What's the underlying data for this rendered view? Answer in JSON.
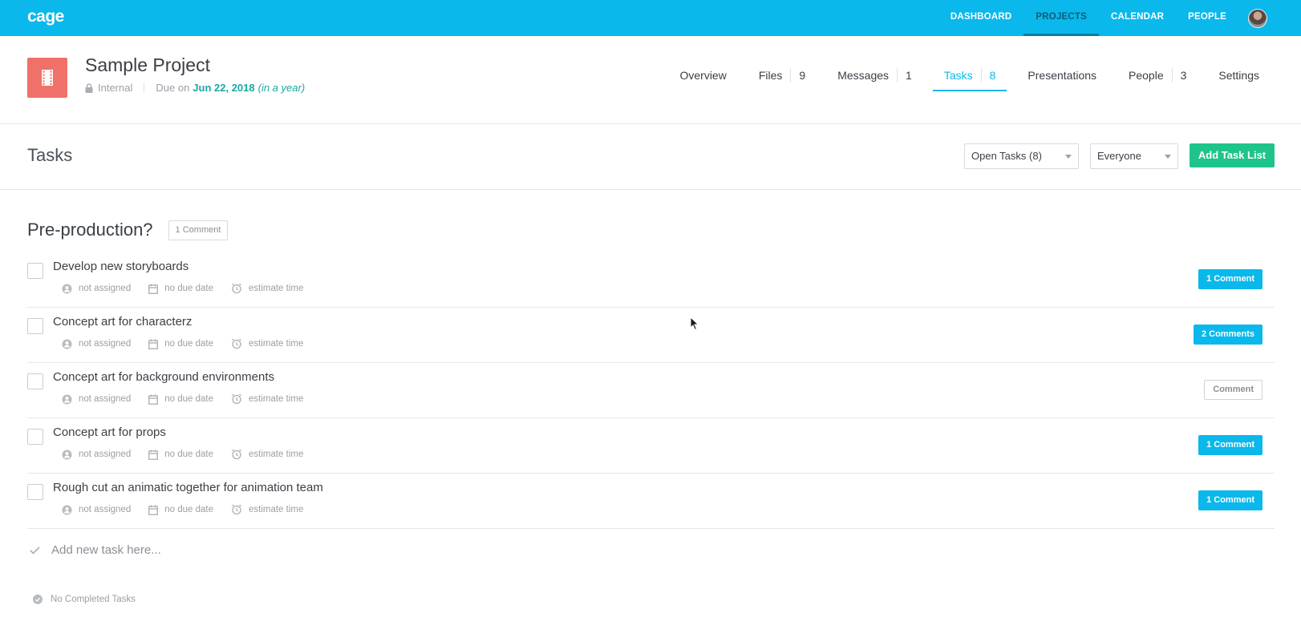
{
  "topbar": {
    "logo": "cage",
    "nav": [
      {
        "label": "DASHBOARD",
        "active": false
      },
      {
        "label": "PROJECTS",
        "active": true
      },
      {
        "label": "CALENDAR",
        "active": false
      },
      {
        "label": "PEOPLE",
        "active": false
      }
    ],
    "avatar_icon": "user-avatar"
  },
  "project": {
    "icon": "film-icon",
    "title": "Sample Project",
    "visibility": "Internal",
    "due_prefix": "Due on",
    "due_date": "Jun 22, 2018",
    "due_relative": "(in a year)",
    "tabs": [
      {
        "label": "Overview",
        "count": "",
        "active": false
      },
      {
        "label": "Files",
        "count": "9",
        "active": false
      },
      {
        "label": "Messages",
        "count": "1",
        "active": false
      },
      {
        "label": "Tasks",
        "count": "8",
        "active": true
      },
      {
        "label": "Presentations",
        "count": "",
        "active": false
      },
      {
        "label": "People",
        "count": "3",
        "active": false
      },
      {
        "label": "Settings",
        "count": "",
        "active": false
      }
    ]
  },
  "tasks_bar": {
    "title": "Tasks",
    "filter_status": "Open Tasks (8)",
    "filter_person": "Everyone",
    "add_list_label": "Add Task List"
  },
  "list": {
    "title": "Pre-production?",
    "comment_label": "1 Comment",
    "tasks": [
      {
        "title": "Develop new storyboards",
        "assignee": "not assigned",
        "due": "no due date",
        "estimate": "estimate time",
        "comments": "1 Comment",
        "has_comments": true
      },
      {
        "title": "Concept art for characterz",
        "assignee": "not assigned",
        "due": "no due date",
        "estimate": "estimate time",
        "comments": "2 Comments",
        "has_comments": true
      },
      {
        "title": "Concept art for background environments",
        "assignee": "not assigned",
        "due": "no due date",
        "estimate": "estimate time",
        "comments": "Comment",
        "has_comments": false
      },
      {
        "title": "Concept art for props",
        "assignee": "not assigned",
        "due": "no due date",
        "estimate": "estimate time",
        "comments": "1 Comment",
        "has_comments": true
      },
      {
        "title": "Rough cut an animatic together for animation team",
        "assignee": "not assigned",
        "due": "no due date",
        "estimate": "estimate time",
        "comments": "1 Comment",
        "has_comments": true
      }
    ],
    "add_task_placeholder": "Add new task here...",
    "no_completed": "No Completed Tasks"
  },
  "colors": {
    "topbar": "#0ab8ec",
    "accent": "#0ab8ec",
    "green_button": "#1fc48a",
    "project_icon": "#f0706a",
    "due_date": "#1aa8a0"
  }
}
